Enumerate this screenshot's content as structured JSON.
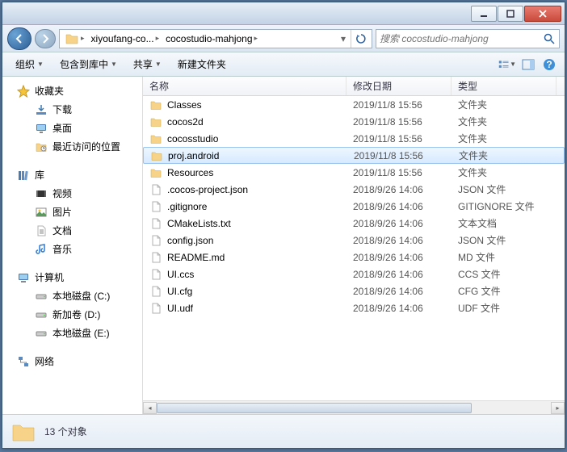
{
  "titlebar": {},
  "breadcrumb": {
    "seg1": "xiyoufang-co...",
    "seg2": "cocostudio-mahjong"
  },
  "search": {
    "placeholder": "搜索 cocostudio-mahjong"
  },
  "toolbar": {
    "organize": "组织",
    "include": "包含到库中",
    "share": "共享",
    "newfolder": "新建文件夹"
  },
  "columns": {
    "name": "名称",
    "date": "修改日期",
    "type": "类型"
  },
  "nav": {
    "favorites": "收藏夹",
    "downloads": "下载",
    "desktop": "桌面",
    "recent": "最近访问的位置",
    "libraries": "库",
    "videos": "视频",
    "pictures": "图片",
    "documents": "文档",
    "music": "音乐",
    "computer": "计算机",
    "diskC": "本地磁盘 (C:)",
    "diskD": "新加卷 (D:)",
    "diskE": "本地磁盘 (E:)",
    "network": "网络"
  },
  "files": [
    {
      "name": "Classes",
      "date": "2019/11/8 15:56",
      "type": "文件夹",
      "kind": "folder"
    },
    {
      "name": "cocos2d",
      "date": "2019/11/8 15:56",
      "type": "文件夹",
      "kind": "folder"
    },
    {
      "name": "cocosstudio",
      "date": "2019/11/8 15:56",
      "type": "文件夹",
      "kind": "folder"
    },
    {
      "name": "proj.android",
      "date": "2019/11/8 15:56",
      "type": "文件夹",
      "kind": "folder",
      "selected": true
    },
    {
      "name": "Resources",
      "date": "2019/11/8 15:56",
      "type": "文件夹",
      "kind": "folder"
    },
    {
      "name": ".cocos-project.json",
      "date": "2018/9/26 14:06",
      "type": "JSON 文件",
      "kind": "file"
    },
    {
      "name": ".gitignore",
      "date": "2018/9/26 14:06",
      "type": "GITIGNORE 文件",
      "kind": "file"
    },
    {
      "name": "CMakeLists.txt",
      "date": "2018/9/26 14:06",
      "type": "文本文档",
      "kind": "file"
    },
    {
      "name": "config.json",
      "date": "2018/9/26 14:06",
      "type": "JSON 文件",
      "kind": "file"
    },
    {
      "name": "README.md",
      "date": "2018/9/26 14:06",
      "type": "MD 文件",
      "kind": "file"
    },
    {
      "name": "UI.ccs",
      "date": "2018/9/26 14:06",
      "type": "CCS 文件",
      "kind": "file"
    },
    {
      "name": "UI.cfg",
      "date": "2018/9/26 14:06",
      "type": "CFG 文件",
      "kind": "file"
    },
    {
      "name": "UI.udf",
      "date": "2018/9/26 14:06",
      "type": "UDF 文件",
      "kind": "file"
    }
  ],
  "status": {
    "count": "13 个对象"
  }
}
